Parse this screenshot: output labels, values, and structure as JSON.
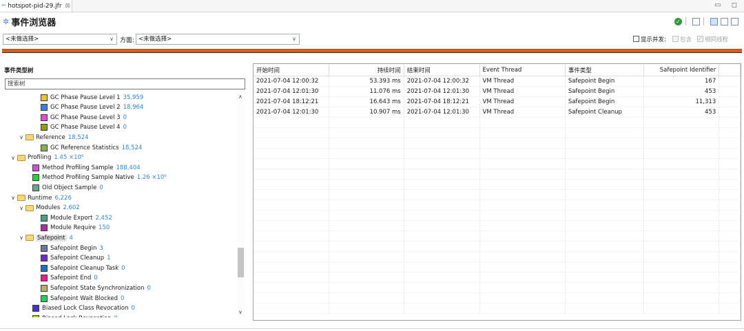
{
  "tab": {
    "title": "hotspot-pid-29.jfr",
    "close": "⊠",
    "icon": "jfr-file-icon"
  },
  "window_controls": "▭ ◻",
  "header": {
    "title": "事件浏览器",
    "icon": "event-browser-icon"
  },
  "filters": {
    "select1_value": "<未做选择>",
    "aspect_label": "方面:",
    "select2_value": "<未做选择>",
    "show_concurrent_label": "显示并发:",
    "contains_label": "包含",
    "same_thread_label": "相同线程"
  },
  "left": {
    "title": "事件类型树",
    "search_value": "搜索树",
    "tree": [
      {
        "level": 2,
        "label": "GC Phase Pause Level 1",
        "count": "35,959",
        "color": "#e8c43a"
      },
      {
        "level": 2,
        "label": "GC Phase Pause Level 2",
        "count": "18,964",
        "color": "#3c7fd6"
      },
      {
        "level": 2,
        "label": "GC Phase Pause Level 3",
        "count": "0",
        "color": "#e04bd8"
      },
      {
        "level": 2,
        "label": "GC Phase Pause Level 4",
        "count": "0",
        "color": "#8f9c16"
      },
      {
        "level": 1,
        "folder": true,
        "label": "Reference",
        "count": "18,524"
      },
      {
        "level": 2,
        "label": "GC Reference Statistics",
        "count": "18,524",
        "color": "#86b054"
      },
      {
        "level": 0,
        "folder": true,
        "label": "Profiling",
        "count": "1.45 ×10⁶"
      },
      {
        "level": 1,
        "label": "Method Profiling Sample",
        "count": "188,404",
        "color": "#d24bdb"
      },
      {
        "level": 1,
        "label": "Method Profiling Sample Native",
        "count": "1.26 ×10⁶",
        "color": "#22d42e"
      },
      {
        "level": 1,
        "label": "Old Object Sample",
        "count": "0",
        "color": "#6aa48f"
      },
      {
        "level": 0,
        "folder": true,
        "label": "Runtime",
        "count": "6,226"
      },
      {
        "level": 1,
        "folder": true,
        "label": "Modules",
        "count": "2,602"
      },
      {
        "level": 2,
        "label": "Module Export",
        "count": "2,452",
        "color": "#4f9f83"
      },
      {
        "level": 2,
        "label": "Module Require",
        "count": "150",
        "color": "#a8329f"
      },
      {
        "level": 1,
        "folder": true,
        "label": "Safepoint",
        "count": "4",
        "selected": true
      },
      {
        "level": 2,
        "label": "Safepoint Begin",
        "count": "3",
        "color": "#6f76a3"
      },
      {
        "level": 2,
        "label": "Safepoint Cleanup",
        "count": "1",
        "color": "#6e2cc9"
      },
      {
        "level": 2,
        "label": "Safepoint Cleanup Task",
        "count": "0",
        "color": "#1f70c2"
      },
      {
        "level": 2,
        "label": "Safepoint End",
        "count": "0",
        "color": "#e5208e"
      },
      {
        "level": 2,
        "label": "Safepoint State Synchronization",
        "count": "0",
        "color": "#b4ae6a"
      },
      {
        "level": 2,
        "label": "Safepoint Wait Blocked",
        "count": "0",
        "color": "#2ec760"
      },
      {
        "level": 1,
        "label": "Biased Lock Class Revocation",
        "count": "0",
        "color": "#4a2fd6"
      },
      {
        "level": 1,
        "label": "Biased Lock Revocation",
        "count": "0",
        "color": "#9fd12c"
      }
    ]
  },
  "table": {
    "columns": [
      "开始时间",
      "持续时间",
      "结束时间",
      "Event Thread",
      "事件类型",
      "Safepoint Identifier"
    ],
    "rows": [
      [
        "2021-07-04 12:00:32",
        "53.393 ms",
        "2021-07-04 12:00:32",
        "VM Thread",
        "Safepoint Begin",
        "167"
      ],
      [
        "2021-07-04 12:01:30",
        "11.076 ms",
        "2021-07-04 12:01:30",
        "VM Thread",
        "Safepoint Begin",
        "453"
      ],
      [
        "2021-07-04 18:12:21",
        "16.643 ms",
        "2021-07-04 18:12:21",
        "VM Thread",
        "Safepoint Begin",
        "11,313"
      ],
      [
        "2021-07-04 12:01:30",
        "10.907 ms",
        "2021-07-04 12:01:30",
        "VM Thread",
        "Safepoint Cleanup",
        "453"
      ]
    ]
  }
}
